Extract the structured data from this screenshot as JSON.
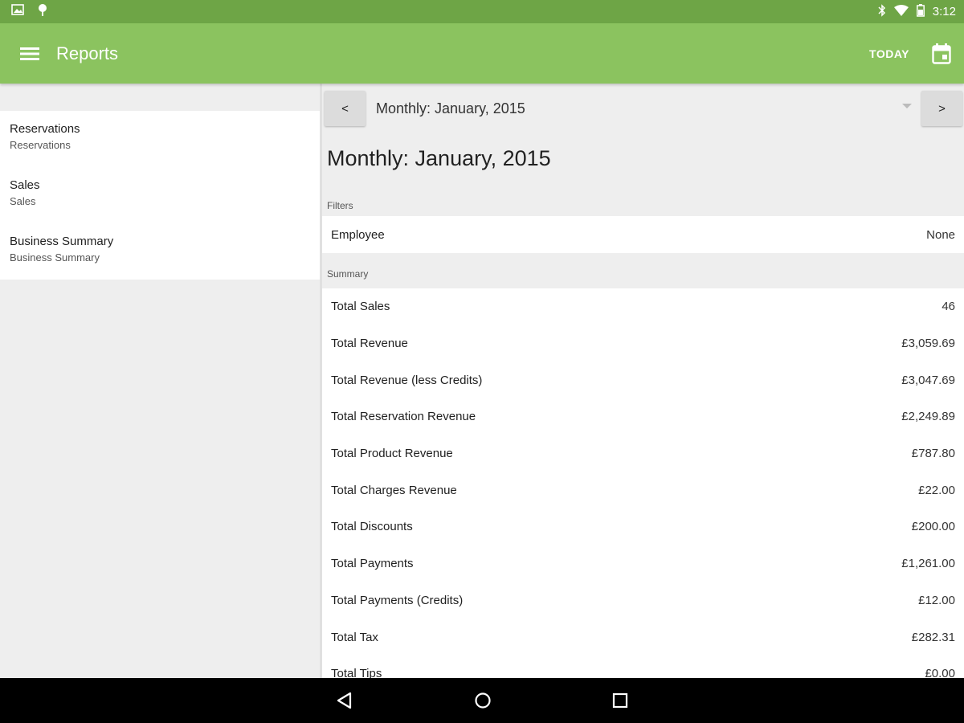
{
  "status_bar": {
    "time": "3:12"
  },
  "app_bar": {
    "title": "Reports",
    "today_label": "TODAY"
  },
  "sidebar": {
    "items": [
      {
        "title": "Reservations",
        "subtitle": "Reservations"
      },
      {
        "title": "Sales",
        "subtitle": "Sales"
      },
      {
        "title": "Business Summary",
        "subtitle": "Business Summary"
      }
    ]
  },
  "period_nav": {
    "prev_label": "<",
    "next_label": ">",
    "selected": "Monthly: January, 2015"
  },
  "report": {
    "heading": "Monthly: January, 2015",
    "filters_label": "Filters",
    "filter": {
      "key": "Employee",
      "value": "None"
    },
    "summary_label": "Summary",
    "summary": [
      {
        "key": "Total Sales",
        "value": "46"
      },
      {
        "key": "Total Revenue",
        "value": "£3,059.69"
      },
      {
        "key": "Total Revenue (less Credits)",
        "value": "£3,047.69"
      },
      {
        "key": "Total Reservation Revenue",
        "value": "£2,249.89"
      },
      {
        "key": "Total Product Revenue",
        "value": "£787.80"
      },
      {
        "key": "Total Charges Revenue",
        "value": "£22.00"
      },
      {
        "key": "Total Discounts",
        "value": "£200.00"
      },
      {
        "key": "Total Payments",
        "value": "£1,261.00"
      },
      {
        "key": "Total Payments (Credits)",
        "value": "£12.00"
      },
      {
        "key": "Total Tax",
        "value": "£282.31"
      },
      {
        "key": "Total Tips",
        "value": "£0.00"
      }
    ]
  },
  "colors": {
    "status_bar": "#6ea546",
    "app_bar": "#8bc35f",
    "background": "#eeeeee"
  }
}
